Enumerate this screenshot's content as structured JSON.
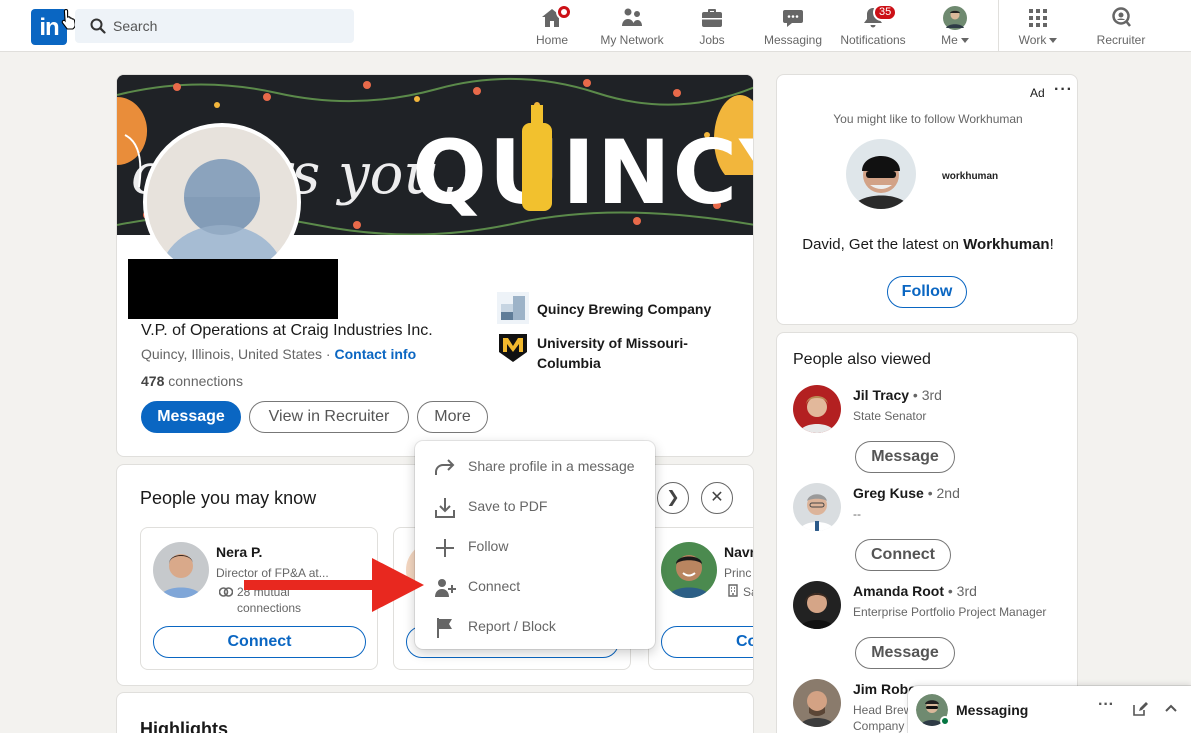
{
  "nav": {
    "search_placeholder": "Search",
    "home": "Home",
    "network": "My Network",
    "jobs": "Jobs",
    "messaging": "Messaging",
    "notifications": "Notifications",
    "notifications_count": "35",
    "me": "Me",
    "work": "Work",
    "recruiter": "Recruiter"
  },
  "profile": {
    "banner_text": "QUINCY",
    "headline": "V.P. of Operations at Craig Industries Inc.",
    "location": "Quincy, Illinois, United States · ",
    "contact_info": "Contact info",
    "connections_count": "478",
    "connections_label": " connections",
    "message_button": "Message",
    "recruiter_button": "View in Recruiter",
    "more_button": "More",
    "companies": [
      {
        "name": "Quincy Brewing Company"
      },
      {
        "name": "University of Missouri-\nColumbia"
      }
    ]
  },
  "more_menu": {
    "items": [
      {
        "label": "Share profile in a message",
        "icon": "share-icon"
      },
      {
        "label": "Save to PDF",
        "icon": "download-icon"
      },
      {
        "label": "Follow",
        "icon": "plus-icon"
      },
      {
        "label": "Connect",
        "icon": "add-person-icon"
      },
      {
        "label": "Report / Block",
        "icon": "flag-icon"
      }
    ]
  },
  "pymk": {
    "title": "People you may know",
    "people": [
      {
        "name": "Nera P.",
        "title": "Director of FP&A at...",
        "mutual": "28 mutual\nconnections",
        "button": "Connect"
      },
      {
        "name": "",
        "title": "",
        "mutual": "",
        "button": ""
      },
      {
        "name": "Navr",
        "title": "Princ",
        "mutual": "Sa",
        "button": "Co"
      }
    ]
  },
  "highlights": {
    "title": "Highlights"
  },
  "ad": {
    "label": "Ad",
    "intro": "You might like to follow Workhuman",
    "brand": "workhuman",
    "pitch_prefix": "David, Get the latest on ",
    "pitch_brand": "Workhuman",
    "pitch_suffix": "!",
    "follow_button": "Follow"
  },
  "people_also_viewed": {
    "title": "People also viewed",
    "people": [
      {
        "name": "Jil Tracy",
        "degree": " • 3rd",
        "title": "State Senator",
        "button": "Message"
      },
      {
        "name": "Greg Kuse",
        "degree": " • 2nd",
        "title": "--",
        "button": "Connect"
      },
      {
        "name": "Amanda Root",
        "degree": " • 3rd",
        "title": "Enterprise Portfolio Project Manager",
        "button": "Message"
      },
      {
        "name": "Jim Robe",
        "degree": "",
        "title": "Head Brew",
        "title2": "Company",
        "button": ""
      }
    ]
  },
  "messaging_bar": {
    "label": "Messaging"
  },
  "colors": {
    "brand_blue": "#0a66c2",
    "badge_red": "#cc1016",
    "annotation_arrow": "#e8281f"
  }
}
